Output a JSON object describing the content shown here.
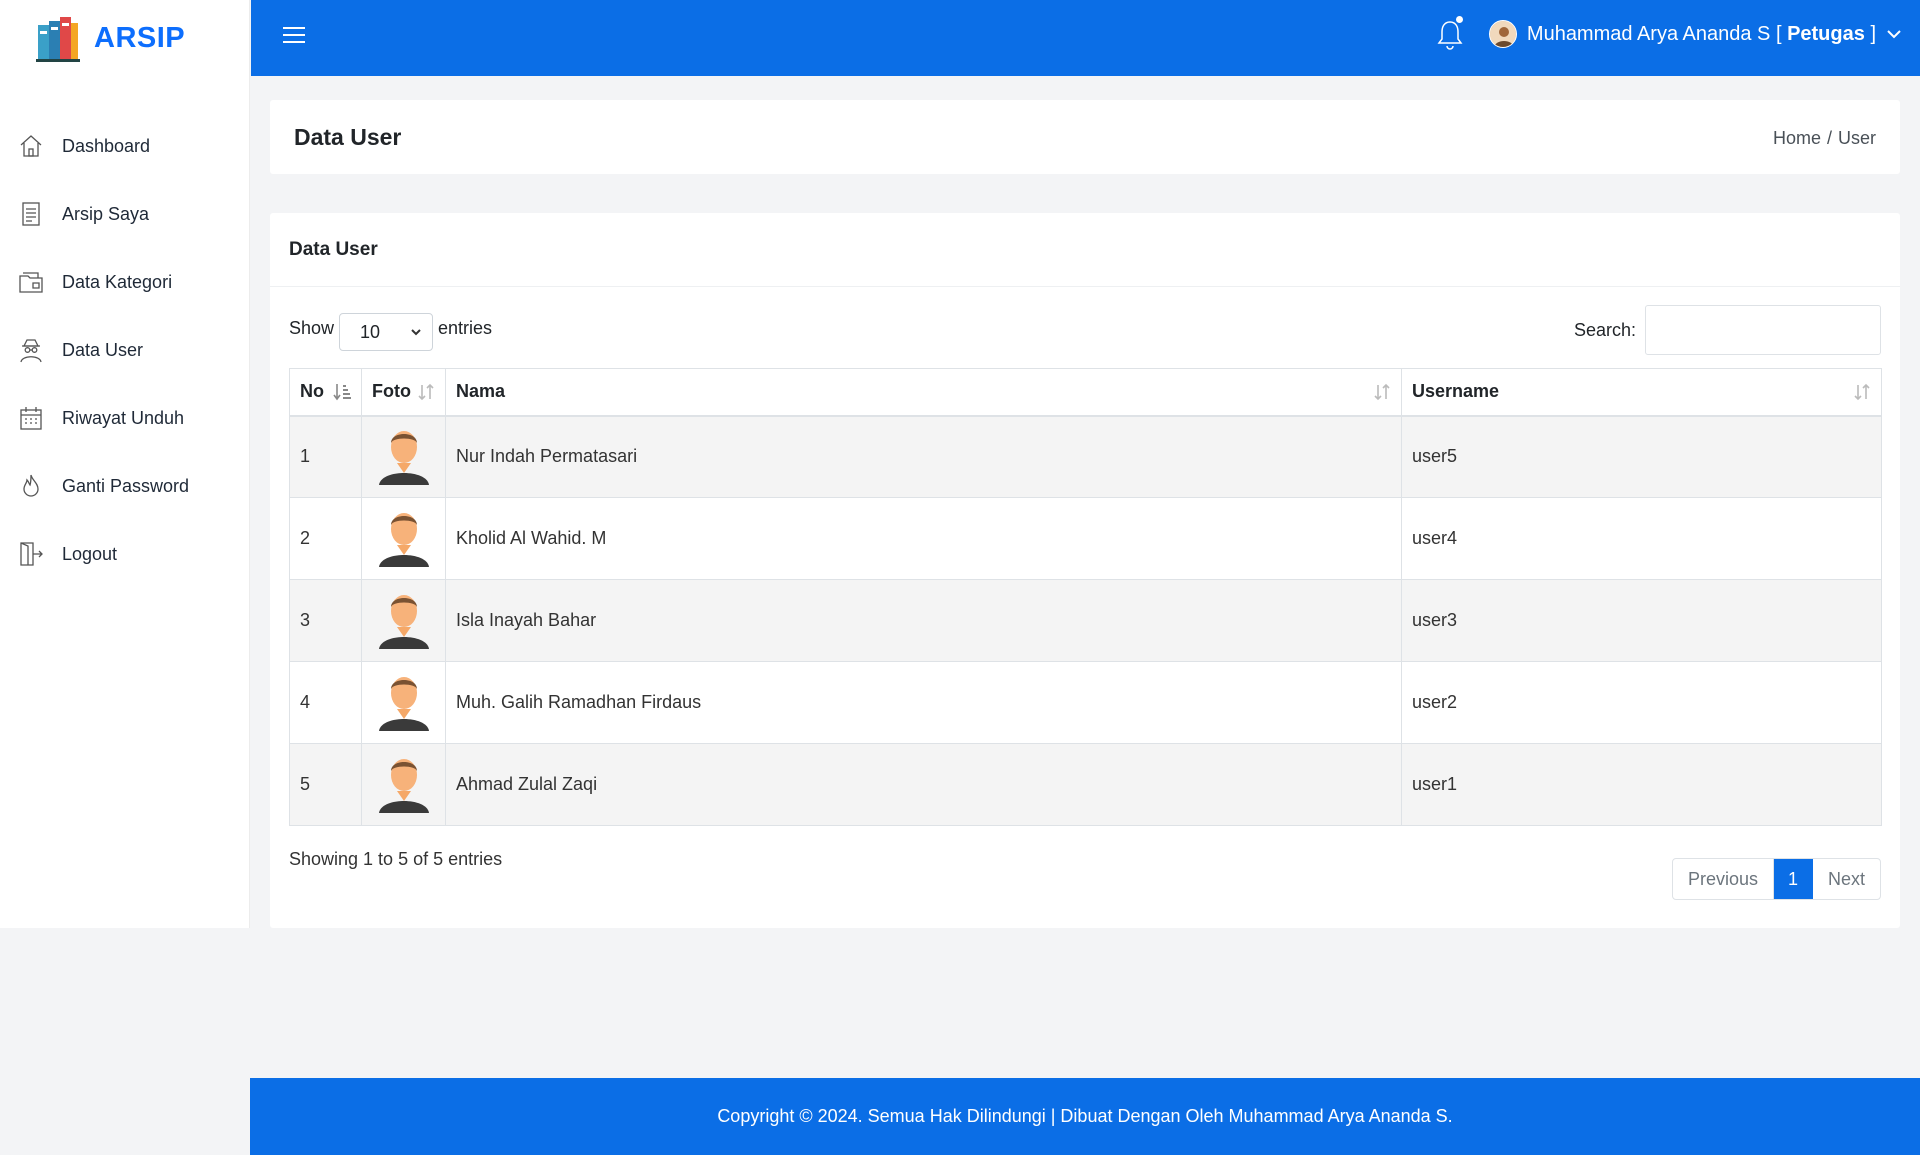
{
  "brand": {
    "name": "ARSIP"
  },
  "sidebar": {
    "items": [
      {
        "label": "Dashboard",
        "icon": "home-icon"
      },
      {
        "label": "Arsip Saya",
        "icon": "document-icon"
      },
      {
        "label": "Data Kategori",
        "icon": "folder-icon"
      },
      {
        "label": "Data User",
        "icon": "user-spy-icon"
      },
      {
        "label": "Riwayat Unduh",
        "icon": "calendar-icon"
      },
      {
        "label": "Ganti Password",
        "icon": "fire-icon"
      },
      {
        "label": "Logout",
        "icon": "logout-icon"
      }
    ]
  },
  "topbar": {
    "user_name": "Muhammad Arya Ananda S [",
    "user_role": "Petugas",
    "user_role_close": "]"
  },
  "page": {
    "title": "Data User",
    "breadcrumb_home": "Home",
    "breadcrumb_sep": "/",
    "breadcrumb_current": "User"
  },
  "card": {
    "title": "Data User",
    "show_label": "Show",
    "entries_label": "entries",
    "page_length": "10",
    "search_label": "Search:",
    "search_value": ""
  },
  "table": {
    "headers": {
      "no": "No",
      "foto": "Foto",
      "nama": "Nama",
      "username": "Username"
    },
    "rows": [
      {
        "no": "1",
        "nama": "Nur Indah Permatasari",
        "username": "user5"
      },
      {
        "no": "2",
        "nama": "Kholid Al Wahid. M",
        "username": "user4"
      },
      {
        "no": "3",
        "nama": "Isla Inayah Bahar",
        "username": "user3"
      },
      {
        "no": "4",
        "nama": "Muh. Galih Ramadhan Firdaus",
        "username": "user2"
      },
      {
        "no": "5",
        "nama": "Ahmad Zulal Zaqi",
        "username": "user1"
      }
    ]
  },
  "pagination": {
    "info": "Showing 1 to 5 of 5 entries",
    "previous": "Previous",
    "current": "1",
    "next": "Next"
  },
  "footer": {
    "text": "Copyright © 2024. Semua Hak Dilindungi | Dibuat Dengan Oleh Muhammad Arya Ananda S."
  },
  "colors": {
    "primary": "#0b6ee6",
    "background": "#f3f4f6"
  }
}
